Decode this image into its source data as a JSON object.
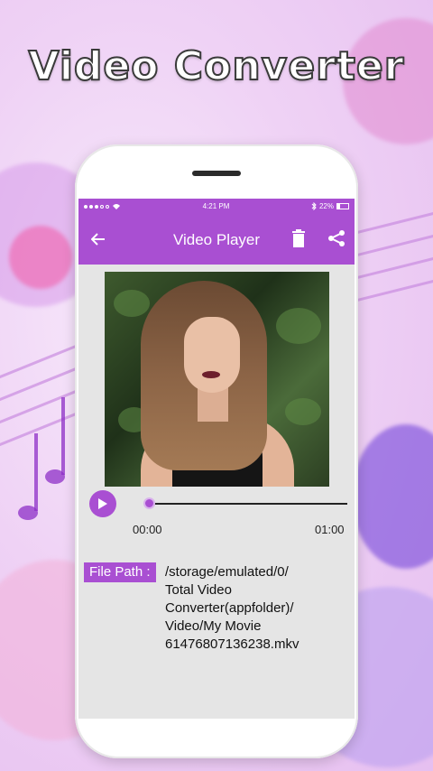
{
  "promo": {
    "title": "Video Converter"
  },
  "status_bar": {
    "time": "4:21 PM",
    "battery": "22%",
    "carrier_icon": "signal-dots-icon",
    "wifi_icon": "wifi-icon",
    "bluetooth_icon": "bluetooth-icon"
  },
  "app_bar": {
    "title": "Video Player",
    "back_icon": "arrow-left-icon",
    "delete_icon": "trash-icon",
    "share_icon": "share-icon"
  },
  "player": {
    "current_time": "00:00",
    "total_time": "01:00",
    "progress": 0.0,
    "play_icon": "play-icon"
  },
  "file_info": {
    "label": "File Path :",
    "path_lines": [
      "/storage/emulated/0/",
      "Total Video",
      "Converter(appfolder)/",
      "Video/My Movie",
      "61476807136238.mkv"
    ]
  },
  "colors": {
    "accent": "#a94fd2",
    "background": "#e5e5e5"
  }
}
